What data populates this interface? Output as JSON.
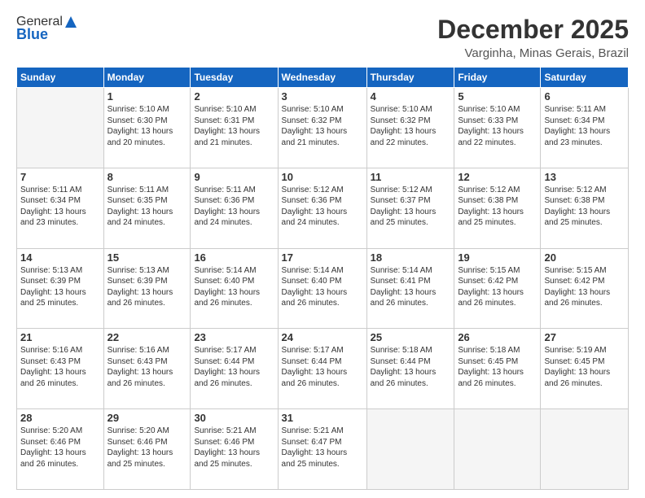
{
  "header": {
    "logo_general": "General",
    "logo_blue": "Blue",
    "month": "December 2025",
    "location": "Varginha, Minas Gerais, Brazil"
  },
  "days_of_week": [
    "Sunday",
    "Monday",
    "Tuesday",
    "Wednesday",
    "Thursday",
    "Friday",
    "Saturday"
  ],
  "weeks": [
    [
      {
        "day": "",
        "info": ""
      },
      {
        "day": "1",
        "info": "Sunrise: 5:10 AM\nSunset: 6:30 PM\nDaylight: 13 hours\nand 20 minutes."
      },
      {
        "day": "2",
        "info": "Sunrise: 5:10 AM\nSunset: 6:31 PM\nDaylight: 13 hours\nand 21 minutes."
      },
      {
        "day": "3",
        "info": "Sunrise: 5:10 AM\nSunset: 6:32 PM\nDaylight: 13 hours\nand 21 minutes."
      },
      {
        "day": "4",
        "info": "Sunrise: 5:10 AM\nSunset: 6:32 PM\nDaylight: 13 hours\nand 22 minutes."
      },
      {
        "day": "5",
        "info": "Sunrise: 5:10 AM\nSunset: 6:33 PM\nDaylight: 13 hours\nand 22 minutes."
      },
      {
        "day": "6",
        "info": "Sunrise: 5:11 AM\nSunset: 6:34 PM\nDaylight: 13 hours\nand 23 minutes."
      }
    ],
    [
      {
        "day": "7",
        "info": "Sunrise: 5:11 AM\nSunset: 6:34 PM\nDaylight: 13 hours\nand 23 minutes."
      },
      {
        "day": "8",
        "info": "Sunrise: 5:11 AM\nSunset: 6:35 PM\nDaylight: 13 hours\nand 24 minutes."
      },
      {
        "day": "9",
        "info": "Sunrise: 5:11 AM\nSunset: 6:36 PM\nDaylight: 13 hours\nand 24 minutes."
      },
      {
        "day": "10",
        "info": "Sunrise: 5:12 AM\nSunset: 6:36 PM\nDaylight: 13 hours\nand 24 minutes."
      },
      {
        "day": "11",
        "info": "Sunrise: 5:12 AM\nSunset: 6:37 PM\nDaylight: 13 hours\nand 25 minutes."
      },
      {
        "day": "12",
        "info": "Sunrise: 5:12 AM\nSunset: 6:38 PM\nDaylight: 13 hours\nand 25 minutes."
      },
      {
        "day": "13",
        "info": "Sunrise: 5:12 AM\nSunset: 6:38 PM\nDaylight: 13 hours\nand 25 minutes."
      }
    ],
    [
      {
        "day": "14",
        "info": "Sunrise: 5:13 AM\nSunset: 6:39 PM\nDaylight: 13 hours\nand 25 minutes."
      },
      {
        "day": "15",
        "info": "Sunrise: 5:13 AM\nSunset: 6:39 PM\nDaylight: 13 hours\nand 26 minutes."
      },
      {
        "day": "16",
        "info": "Sunrise: 5:14 AM\nSunset: 6:40 PM\nDaylight: 13 hours\nand 26 minutes."
      },
      {
        "day": "17",
        "info": "Sunrise: 5:14 AM\nSunset: 6:40 PM\nDaylight: 13 hours\nand 26 minutes."
      },
      {
        "day": "18",
        "info": "Sunrise: 5:14 AM\nSunset: 6:41 PM\nDaylight: 13 hours\nand 26 minutes."
      },
      {
        "day": "19",
        "info": "Sunrise: 5:15 AM\nSunset: 6:42 PM\nDaylight: 13 hours\nand 26 minutes."
      },
      {
        "day": "20",
        "info": "Sunrise: 5:15 AM\nSunset: 6:42 PM\nDaylight: 13 hours\nand 26 minutes."
      }
    ],
    [
      {
        "day": "21",
        "info": "Sunrise: 5:16 AM\nSunset: 6:43 PM\nDaylight: 13 hours\nand 26 minutes."
      },
      {
        "day": "22",
        "info": "Sunrise: 5:16 AM\nSunset: 6:43 PM\nDaylight: 13 hours\nand 26 minutes."
      },
      {
        "day": "23",
        "info": "Sunrise: 5:17 AM\nSunset: 6:44 PM\nDaylight: 13 hours\nand 26 minutes."
      },
      {
        "day": "24",
        "info": "Sunrise: 5:17 AM\nSunset: 6:44 PM\nDaylight: 13 hours\nand 26 minutes."
      },
      {
        "day": "25",
        "info": "Sunrise: 5:18 AM\nSunset: 6:44 PM\nDaylight: 13 hours\nand 26 minutes."
      },
      {
        "day": "26",
        "info": "Sunrise: 5:18 AM\nSunset: 6:45 PM\nDaylight: 13 hours\nand 26 minutes."
      },
      {
        "day": "27",
        "info": "Sunrise: 5:19 AM\nSunset: 6:45 PM\nDaylight: 13 hours\nand 26 minutes."
      }
    ],
    [
      {
        "day": "28",
        "info": "Sunrise: 5:20 AM\nSunset: 6:46 PM\nDaylight: 13 hours\nand 26 minutes."
      },
      {
        "day": "29",
        "info": "Sunrise: 5:20 AM\nSunset: 6:46 PM\nDaylight: 13 hours\nand 25 minutes."
      },
      {
        "day": "30",
        "info": "Sunrise: 5:21 AM\nSunset: 6:46 PM\nDaylight: 13 hours\nand 25 minutes."
      },
      {
        "day": "31",
        "info": "Sunrise: 5:21 AM\nSunset: 6:47 PM\nDaylight: 13 hours\nand 25 minutes."
      },
      {
        "day": "",
        "info": ""
      },
      {
        "day": "",
        "info": ""
      },
      {
        "day": "",
        "info": ""
      }
    ]
  ]
}
